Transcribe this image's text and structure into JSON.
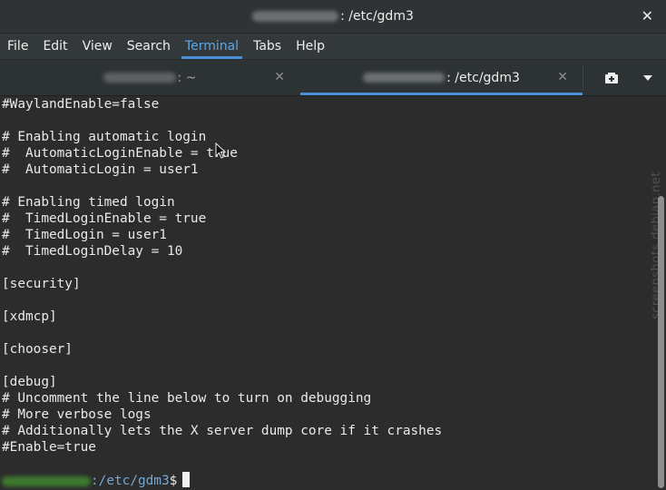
{
  "window": {
    "title_path": ": /etc/gdm3",
    "close_glyph": "✕"
  },
  "menubar": {
    "items": [
      "File",
      "Edit",
      "View",
      "Search",
      "Terminal",
      "Tabs",
      "Help"
    ],
    "active": "Terminal"
  },
  "tabs": [
    {
      "label": ": ~",
      "close_glyph": "✕"
    },
    {
      "label": ": /etc/gdm3",
      "close_glyph": "✕"
    }
  ],
  "terminal": {
    "lines": [
      "#WaylandEnable=false",
      "",
      "# Enabling automatic login",
      "#  AutomaticLoginEnable = true",
      "#  AutomaticLogin = user1",
      "",
      "# Enabling timed login",
      "#  TimedLoginEnable = true",
      "#  TimedLogin = user1",
      "#  TimedLoginDelay = 10",
      "",
      "[security]",
      "",
      "[xdmcp]",
      "",
      "[chooser]",
      "",
      "[debug]",
      "# Uncomment the line below to turn on debugging",
      "# More verbose logs",
      "# Additionally lets the X server dump core if it crashes",
      "#Enable=true"
    ],
    "prompt_path": ":/etc/gdm3",
    "prompt_symbol": "$"
  },
  "watermark": "screenshots.debian.net",
  "icons": {
    "new_tab": "new-tab-icon",
    "menu": "chevron-down-icon"
  }
}
